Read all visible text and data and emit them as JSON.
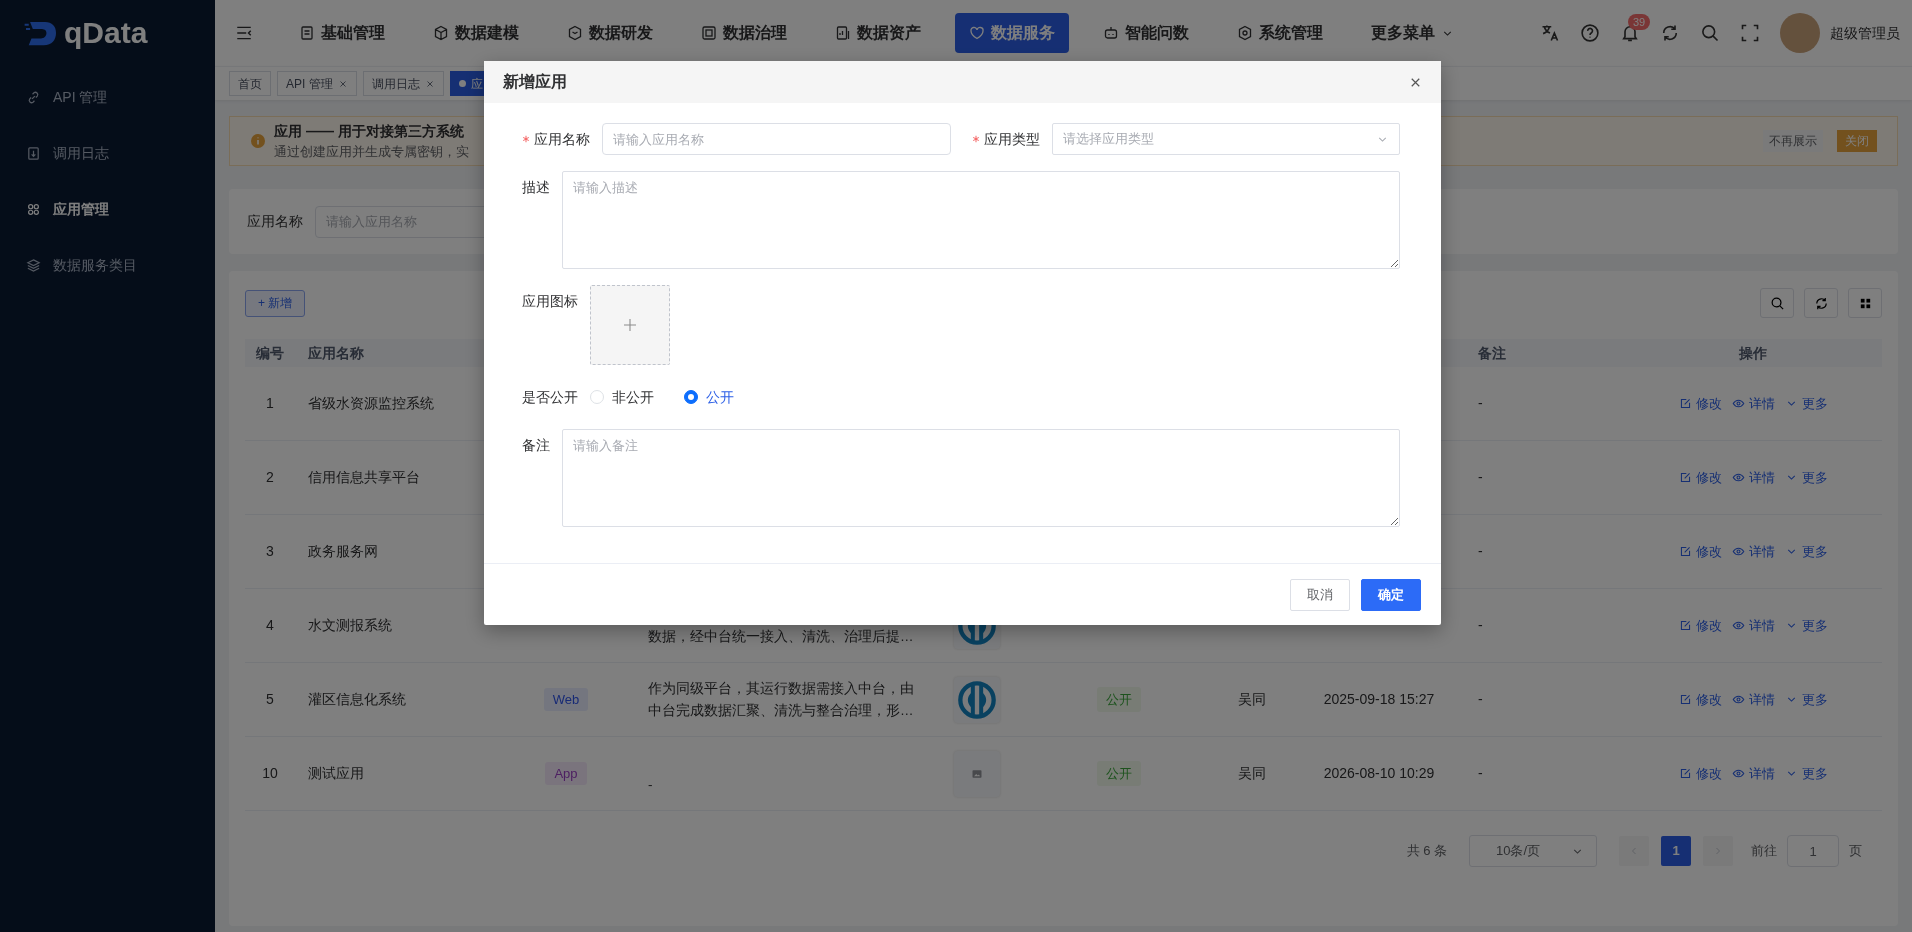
{
  "sidebar": {
    "logo": "qData",
    "items": [
      {
        "label": "API 管理",
        "selected": false
      },
      {
        "label": "调用日志",
        "selected": false
      },
      {
        "label": "应用管理",
        "selected": true
      },
      {
        "label": "数据服务类目",
        "selected": false
      }
    ]
  },
  "topnav": {
    "items": [
      {
        "label": "基础管理",
        "selected": false
      },
      {
        "label": "数据建模",
        "selected": false
      },
      {
        "label": "数据研发",
        "selected": false
      },
      {
        "label": "数据治理",
        "selected": false
      },
      {
        "label": "数据资产",
        "selected": false
      },
      {
        "label": "数据服务",
        "selected": true
      },
      {
        "label": "智能问数",
        "selected": false
      },
      {
        "label": "系统管理",
        "selected": false
      },
      {
        "label": "更多菜单",
        "selected": false
      }
    ],
    "notification_count": "39",
    "user": "超级管理员"
  },
  "tabs": [
    {
      "label": "首页",
      "closable": false,
      "selected": false
    },
    {
      "label": "API 管理",
      "closable": true,
      "selected": false
    },
    {
      "label": "调用日志",
      "closable": true,
      "selected": false
    },
    {
      "label": "应",
      "closable": false,
      "selected": true
    }
  ],
  "alert": {
    "title": "应用 —— 用于对接第三方系统",
    "text": "通过创建应用并生成专属密钥，实",
    "buttons": [
      {
        "label": "不再展示",
        "kind": "text"
      },
      {
        "label": "关闭",
        "kind": "warning"
      }
    ]
  },
  "filter": {
    "label": "应用名称",
    "placeholder": "请输入应用名称"
  },
  "toolbar": {
    "add": "+ 新增"
  },
  "table": {
    "columns": [
      "编号",
      "应用名称",
      null,
      null,
      null,
      null,
      null,
      null,
      "备注",
      "操作"
    ],
    "rows": [
      {
        "id": "1",
        "name": "省级水资源监控系统",
        "remark": "-",
        "actions": [
          "修改",
          "详情",
          "更多"
        ]
      },
      {
        "id": "2",
        "name": "信用信息共享平台",
        "remark": "-",
        "actions": [
          "修改",
          "详情",
          "更多"
        ]
      },
      {
        "id": "3",
        "name": "政务服务网",
        "remark": "-",
        "actions": [
          "修改",
          "详情",
          "更多"
        ]
      },
      {
        "id": "4",
        "name": "水文测报系统",
        "description": "数据，经中台统一接入、清洗、治理后提…",
        "image": {
          "kind": "logo"
        },
        "remark": "-",
        "actions": [
          "修改",
          "详情",
          "更多"
        ]
      },
      {
        "id": "5",
        "name": "灌区信息化系统",
        "type": {
          "text": "Web",
          "kind": "primary"
        },
        "description": "作为同级平台，其运行数据需接入中台，由中台完成数据汇聚、清洗与整合治理，形…",
        "image": {
          "kind": "logo"
        },
        "public": "公开",
        "creator": "吴同",
        "created": "2025-09-18 15:27",
        "remark": "-",
        "actions": [
          "修改",
          "详情",
          "更多"
        ]
      },
      {
        "id": "10",
        "name": "测试应用",
        "type": {
          "text": "App",
          "kind": "accent"
        },
        "description": "-",
        "image": {
          "kind": "placeholder"
        },
        "public": "公开",
        "creator": "吴同",
        "created": "2026-08-10 10:29",
        "remark": "-",
        "actions": [
          "修改",
          "详情",
          "更多"
        ]
      }
    ]
  },
  "pagination": {
    "total": "共 6 条",
    "page_size": "10条/页",
    "pages": [
      {
        "label": "1",
        "selected": true
      }
    ],
    "goto_label": "前往",
    "goto_value": "1",
    "goto_suffix": "页"
  },
  "dialog": {
    "title": "新增应用",
    "fields": [
      {
        "kind": "input",
        "label": "应用名称",
        "required": true,
        "placeholder": "请输入应用名称"
      },
      {
        "kind": "select",
        "label": "应用类型",
        "required": true,
        "placeholder": "请选择应用类型"
      },
      {
        "kind": "textarea",
        "label": "描述",
        "required": false,
        "placeholder": "请输入描述"
      },
      {
        "kind": "upload",
        "label": "应用图标",
        "required": false
      },
      {
        "kind": "radio",
        "label": "是否公开",
        "required": false,
        "options": [
          {
            "label": "非公开",
            "selected": false
          },
          {
            "label": "公开",
            "selected": true
          }
        ]
      },
      {
        "kind": "textarea",
        "label": "备注",
        "required": false,
        "placeholder": "请输入备注"
      }
    ],
    "buttons": [
      {
        "label": "取消",
        "kind": "default"
      },
      {
        "label": "确定",
        "kind": "primary"
      }
    ]
  }
}
